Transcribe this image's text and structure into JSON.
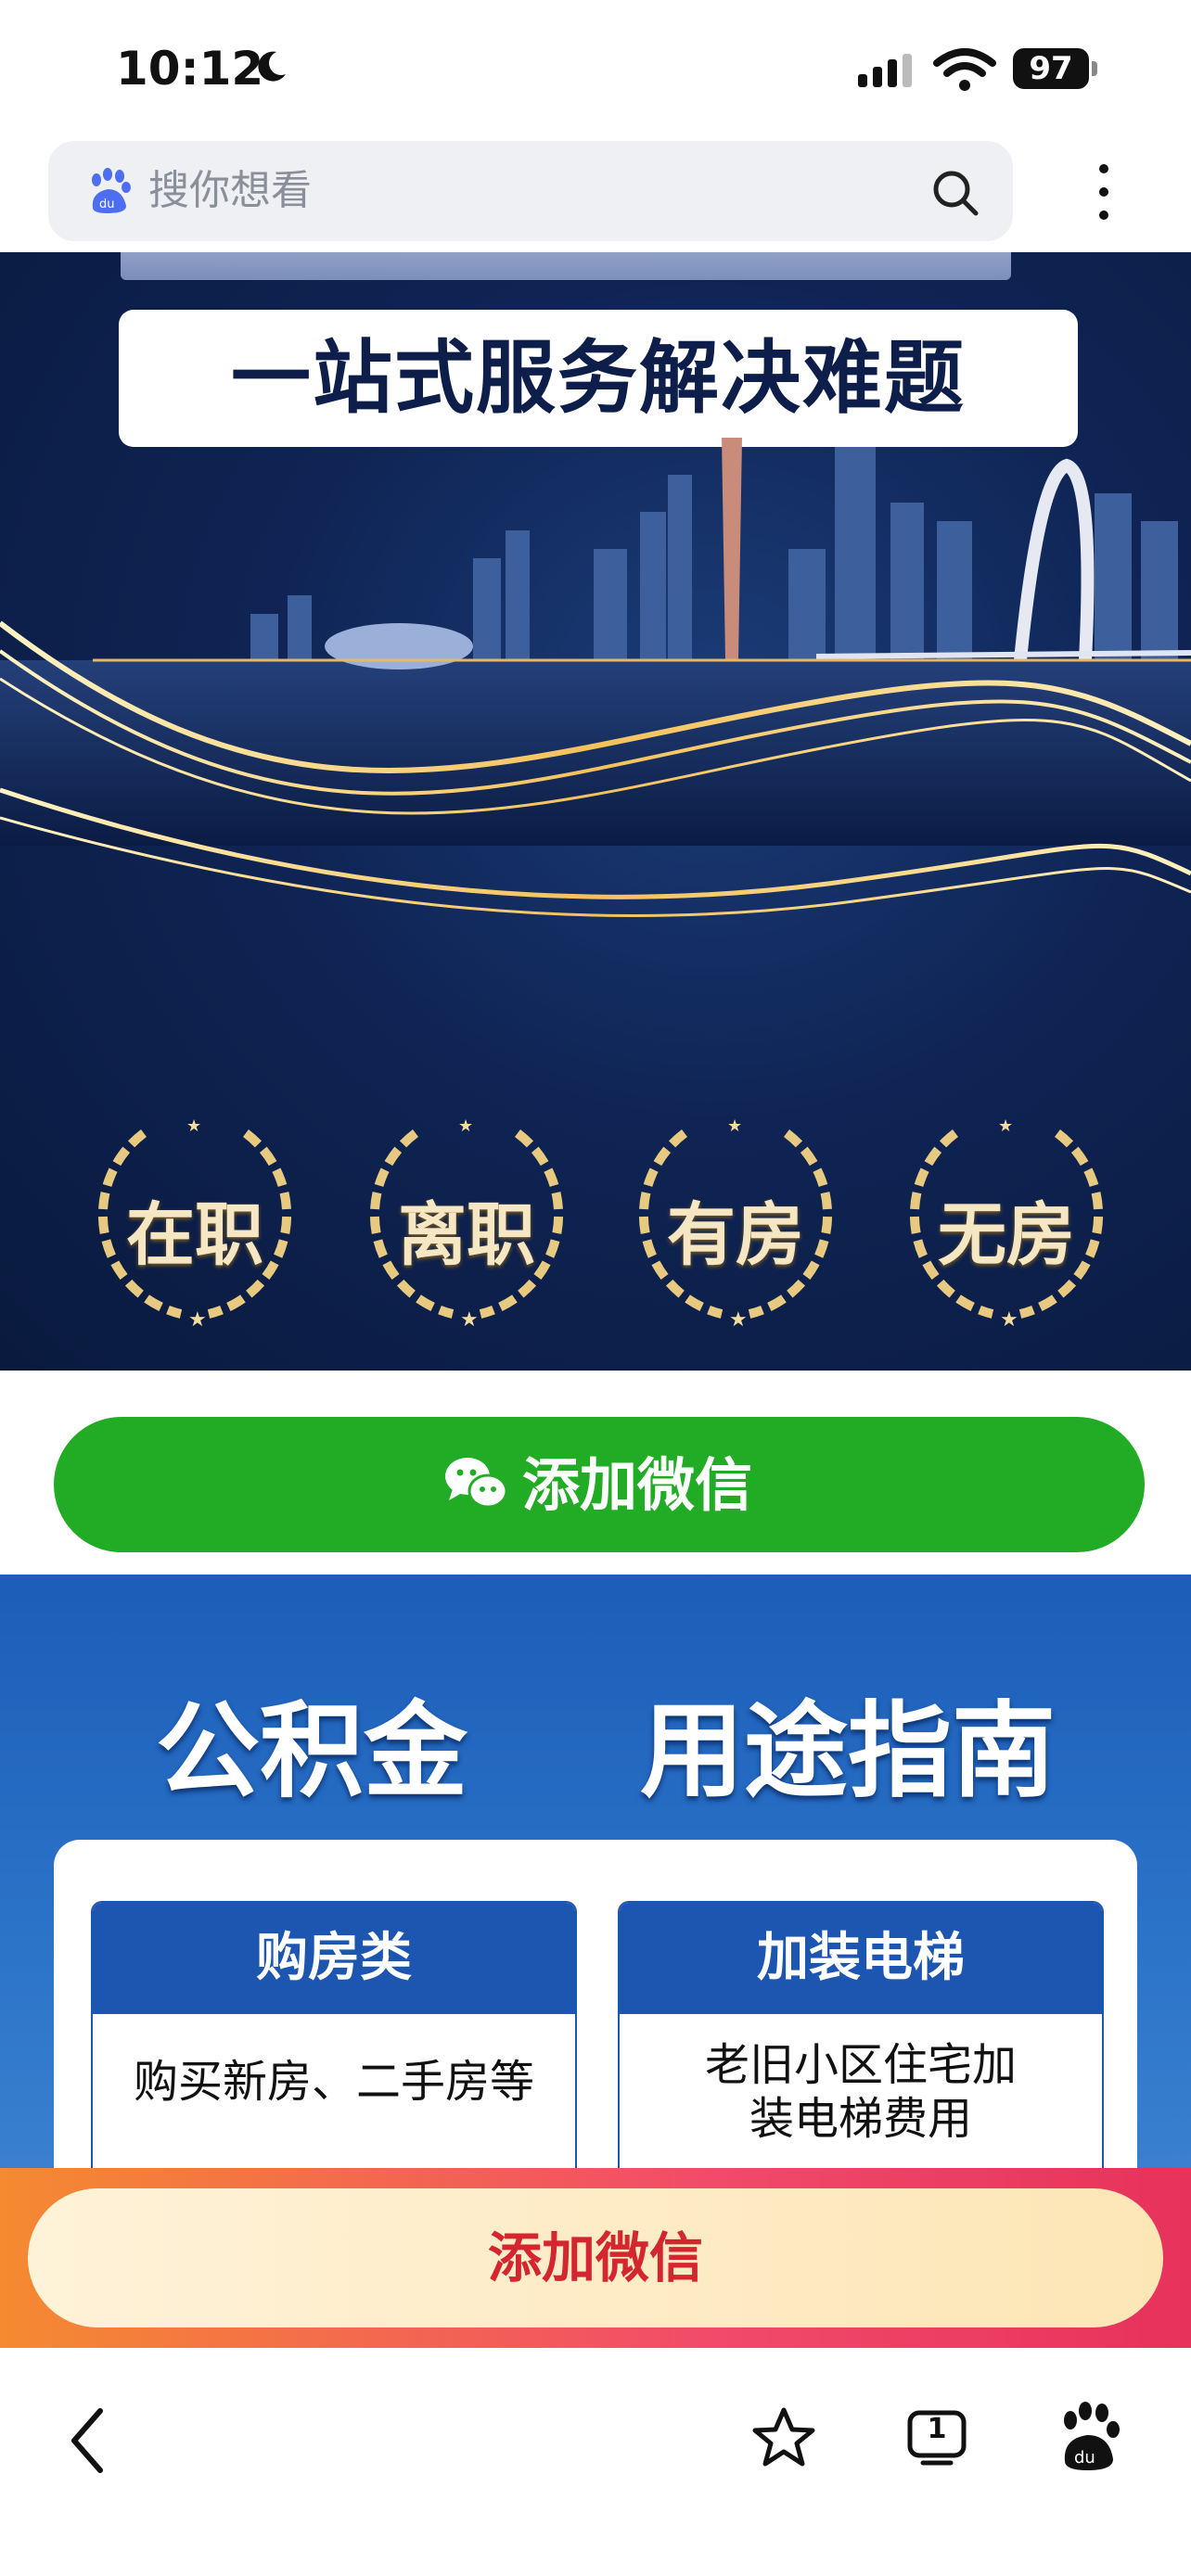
{
  "status": {
    "time": "10:12",
    "battery": "97"
  },
  "search": {
    "placeholder": "搜你想看"
  },
  "hero": {
    "title": "一站式服务解决难题",
    "badges": [
      "在职",
      "离职",
      "有房",
      "无房"
    ]
  },
  "wechat_button": {
    "label": "添加微信"
  },
  "guide": {
    "heading_left": "公积金",
    "heading_right": "用途指南",
    "columns": [
      {
        "title": "购房类",
        "desc_line1": "购买新房、二手房等",
        "desc_line2": ""
      },
      {
        "title": "加装电梯",
        "desc_line1": "老旧小区住宅加",
        "desc_line2": "装电梯费用"
      }
    ]
  },
  "floating_banner": {
    "label": "添加微信"
  },
  "bottom_bar": {
    "tab_count": "1"
  },
  "colors": {
    "wechat_green": "#22ac26",
    "guide_blue": "#1d56b0",
    "banner_red": "#d4262e"
  },
  "icons": [
    "moon-icon",
    "cellular-icon",
    "wifi-icon",
    "battery-icon",
    "baidu-paw-icon",
    "search-icon",
    "more-icon",
    "wechat-icon",
    "back-icon",
    "star-icon",
    "tabs-icon",
    "baidu-home-icon"
  ]
}
